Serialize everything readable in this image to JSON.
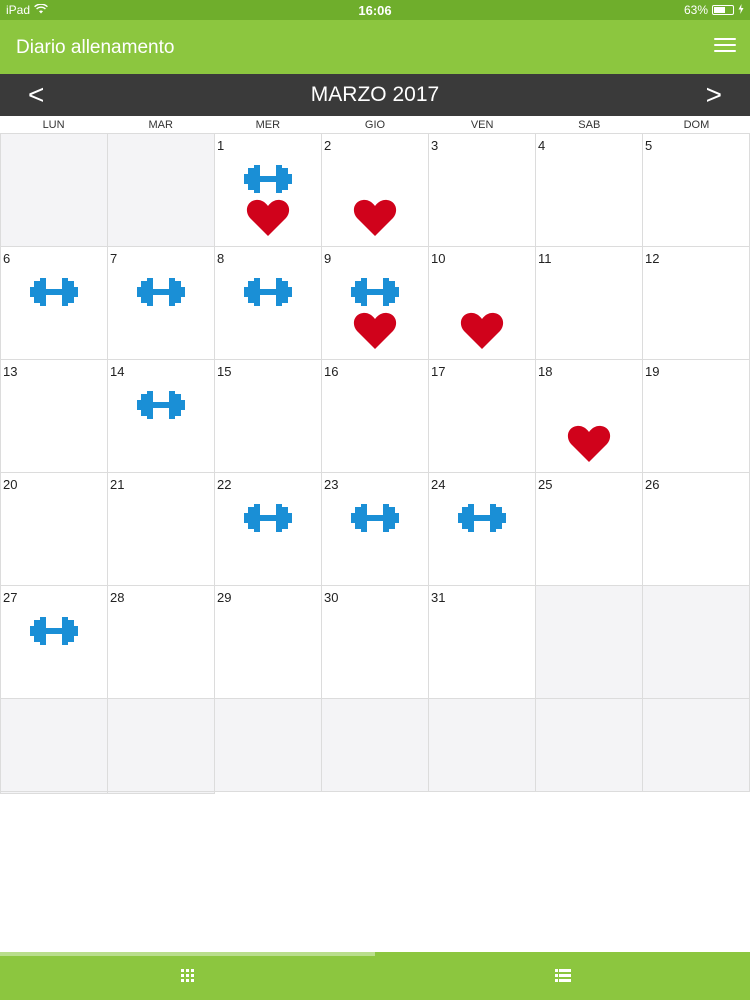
{
  "status_bar": {
    "device": "iPad",
    "time": "16:06",
    "battery_text": "63%",
    "battery_level": 0.63
  },
  "header": {
    "title": "Diario allenamento",
    "menu_icon": "hamburger-menu-icon"
  },
  "month_bar": {
    "title": "MARZO 2017",
    "prev": "<",
    "next": ">"
  },
  "weekdays": [
    "LUN",
    "MAR",
    "MER",
    "GIO",
    "VEN",
    "SAB",
    "DOM"
  ],
  "calendar": {
    "leading_empty": 2,
    "trailing_empty": 11,
    "days": [
      {
        "day": "1",
        "workout": true,
        "cardio": true
      },
      {
        "day": "2",
        "workout": false,
        "cardio": true
      },
      {
        "day": "3",
        "workout": false,
        "cardio": false
      },
      {
        "day": "4",
        "workout": false,
        "cardio": false
      },
      {
        "day": "5",
        "workout": false,
        "cardio": false
      },
      {
        "day": "6",
        "workout": true,
        "cardio": false
      },
      {
        "day": "7",
        "workout": true,
        "cardio": false
      },
      {
        "day": "8",
        "workout": true,
        "cardio": false
      },
      {
        "day": "9",
        "workout": true,
        "cardio": true
      },
      {
        "day": "10",
        "workout": false,
        "cardio": true
      },
      {
        "day": "11",
        "workout": false,
        "cardio": false
      },
      {
        "day": "12",
        "workout": false,
        "cardio": false
      },
      {
        "day": "13",
        "workout": false,
        "cardio": false
      },
      {
        "day": "14",
        "workout": true,
        "cardio": false
      },
      {
        "day": "15",
        "workout": false,
        "cardio": false
      },
      {
        "day": "16",
        "workout": false,
        "cardio": false
      },
      {
        "day": "17",
        "workout": false,
        "cardio": false
      },
      {
        "day": "18",
        "workout": false,
        "cardio": true
      },
      {
        "day": "19",
        "workout": false,
        "cardio": false
      },
      {
        "day": "20",
        "workout": false,
        "cardio": false
      },
      {
        "day": "21",
        "workout": false,
        "cardio": false
      },
      {
        "day": "22",
        "workout": true,
        "cardio": false
      },
      {
        "day": "23",
        "workout": true,
        "cardio": false
      },
      {
        "day": "24",
        "workout": true,
        "cardio": false
      },
      {
        "day": "25",
        "workout": false,
        "cardio": false
      },
      {
        "day": "26",
        "workout": false,
        "cardio": false
      },
      {
        "day": "27",
        "workout": true,
        "cardio": false
      },
      {
        "day": "28",
        "workout": false,
        "cardio": false
      },
      {
        "day": "29",
        "workout": false,
        "cardio": false
      },
      {
        "day": "30",
        "workout": false,
        "cardio": false
      },
      {
        "day": "31",
        "workout": false,
        "cardio": false
      }
    ]
  },
  "icons": {
    "workout": "dumbbell-icon",
    "cardio": "heart-icon"
  },
  "tab_bar": {
    "tabs": [
      {
        "icon": "grid-icon",
        "selected": true
      },
      {
        "icon": "list-icon",
        "selected": false
      }
    ]
  },
  "colors": {
    "header_green": "#8cc63f",
    "status_green": "#6fae2c",
    "month_bar": "#3a3a3a",
    "dumbbell_blue": "#1a8fd6",
    "heart_red": "#d0021b",
    "empty_cell": "#f4f4f6"
  }
}
